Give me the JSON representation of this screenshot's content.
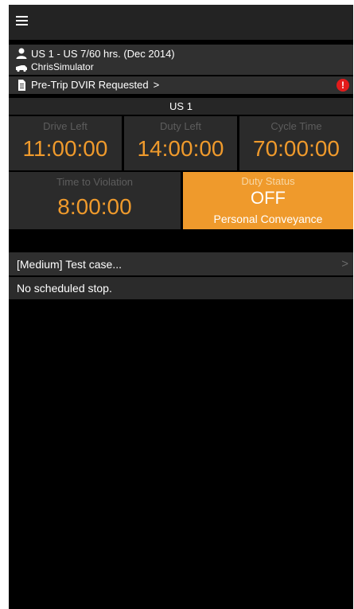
{
  "header": {
    "menu_icon": "hamburger-menu-icon"
  },
  "driver": {
    "ruleset_text": "US 1 - US 7/60 hrs. (Dec 2014)",
    "vehicle_name": "ChrisSimulator",
    "user_icon": "user-icon",
    "truck_icon": "truck-icon"
  },
  "dvir": {
    "label": "Pre-Trip DVIR Requested",
    "chevron": ">",
    "doc_icon": "document-icon",
    "alert_symbol": "!",
    "alert_icon": "alert-icon",
    "alert_color": "#e31b1b"
  },
  "ruleset": {
    "title": "US 1"
  },
  "hos": {
    "accent": "#ef9a2c",
    "drive_left": {
      "label": "Drive Left",
      "value": "11:00:00"
    },
    "duty_left": {
      "label": "Duty Left",
      "value": "14:00:00"
    },
    "cycle_time": {
      "label": "Cycle Time",
      "value": "70:00:00"
    },
    "time_to_violation": {
      "label": "Time to Violation",
      "value": "8:00:00"
    },
    "duty_status": {
      "label": "Duty Status",
      "status": "OFF",
      "sub": "Personal Conveyance"
    }
  },
  "messages": {
    "test_case": "[Medium]  Test case...",
    "chevron": ">"
  },
  "stop": {
    "text": "No scheduled stop."
  }
}
